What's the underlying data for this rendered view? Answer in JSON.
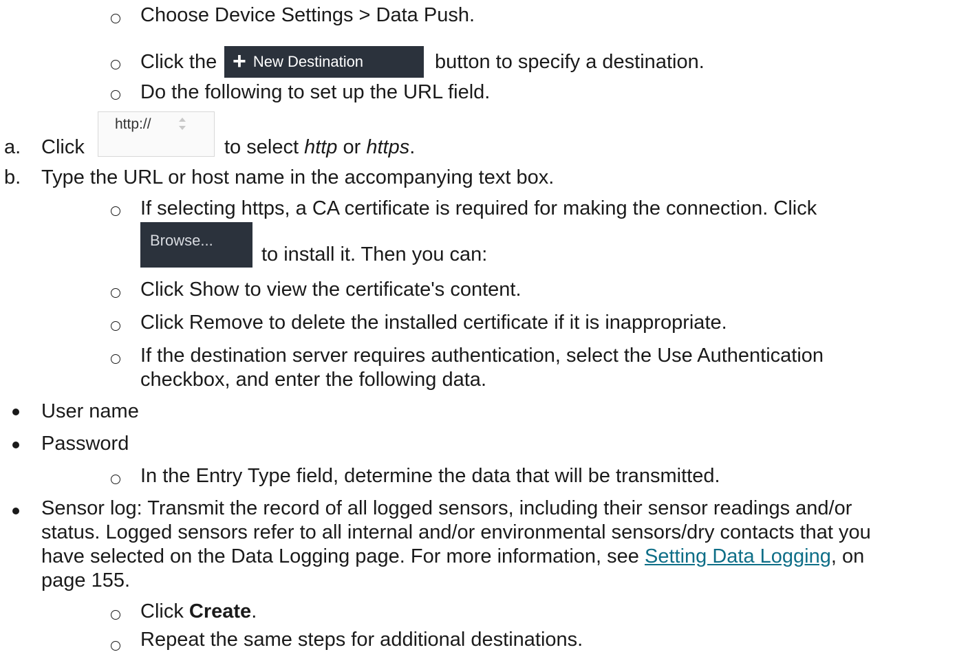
{
  "steps": {
    "choose_device_settings": "Choose Device Settings > Data Push.",
    "click_the": "Click the",
    "new_destination_button": "New Destination",
    "button_to_specify": "button to specify a destination.",
    "do_following": "Do the following to set up the URL field."
  },
  "url_field": {
    "a_marker": "a.",
    "a_click": "Click",
    "protocol_value": "http://",
    "a_to_select": "to select",
    "http": "http",
    "or": "or",
    "https": "https",
    "period": ".",
    "b_marker": "b.",
    "b_text": "Type the URL or host name in the accompanying text box."
  },
  "https_steps": {
    "if_selecting": "If selecting https, a CA certificate is required for making the connection. Click",
    "browse_button": "Browse...",
    "to_install": "to install it. Then you can:",
    "click_show": "Click Show to view the certificate's content.",
    "click_remove": "Click Remove to delete the installed certificate if it is inappropriate.",
    "auth_line1": "If the destination server requires authentication, select the Use Authentication",
    "auth_line2": "checkbox, and enter the following data."
  },
  "auth_fields": {
    "user_name": "User name",
    "password": "Password"
  },
  "entry_type": {
    "text": "In the Entry Type field, determine the data that will be transmitted.",
    "sensor_log_line1": "Sensor log: Transmit the record of all logged sensors, including their sensor readings and/or",
    "sensor_log_line2": "status. Logged sensors refer to all internal and/or environmental sensors/dry contacts that you",
    "sensor_log_line3a": "have selected on the Data Logging page. For more information, see",
    "link_text": "Setting Data Logging",
    "sensor_log_line3b": ", on",
    "sensor_log_line4": "page 155."
  },
  "final_steps": {
    "click": "Click",
    "create": "Create",
    "period": ".",
    "repeat": "Repeat the same steps for additional destinations."
  },
  "colors": {
    "button_bg": "#2b323c",
    "link": "#0e6e87",
    "text": "#1a1a1a"
  }
}
